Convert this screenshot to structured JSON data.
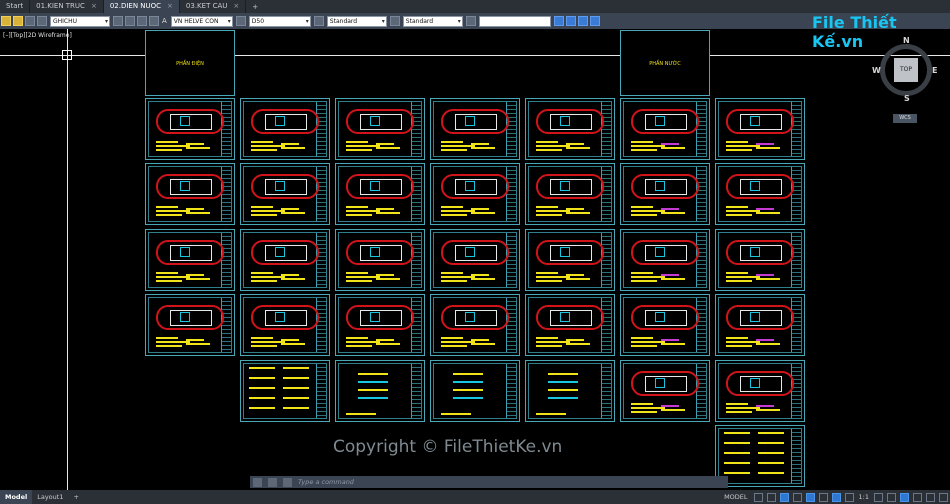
{
  "tabs": [
    {
      "label": "Start",
      "active": false
    },
    {
      "label": "01.KIEN TRUC",
      "active": false
    },
    {
      "label": "02.DIEN NUOC",
      "active": true
    },
    {
      "label": "03.KET CAU",
      "active": false
    }
  ],
  "toolbar": {
    "layer_value": "GHICHU",
    "text_style": "VN HELVE CON",
    "dim_style": "D50",
    "table_style": "Standard",
    "multileader_style": "Standard",
    "search_value": ""
  },
  "viewport_label": "[–][Top][2D Wireframe]",
  "viewcube": {
    "top_label": "TOP",
    "north": "N",
    "south": "S",
    "east": "E",
    "west": "W",
    "wcs_label": "WCS"
  },
  "sheets": {
    "top_left_label": "PHẦN ĐIỆN",
    "top_right_label": "PHẦN NƯỚC"
  },
  "command_line": {
    "placeholder": "Type a command"
  },
  "layout_tabs": [
    {
      "label": "Model",
      "active": true
    },
    {
      "label": "Layout1",
      "active": false
    }
  ],
  "status": {
    "model_label": "MODEL",
    "scale": "1:1"
  },
  "watermark": "Copyright © FileThietKe.vn",
  "logo": "File Thiết Kế.vn",
  "colors": {
    "cyan_frame": "#49a8b8",
    "wall_red": "#d2141a",
    "legend_yellow": "#f1e31a",
    "accent_blue": "#2f78d0"
  }
}
